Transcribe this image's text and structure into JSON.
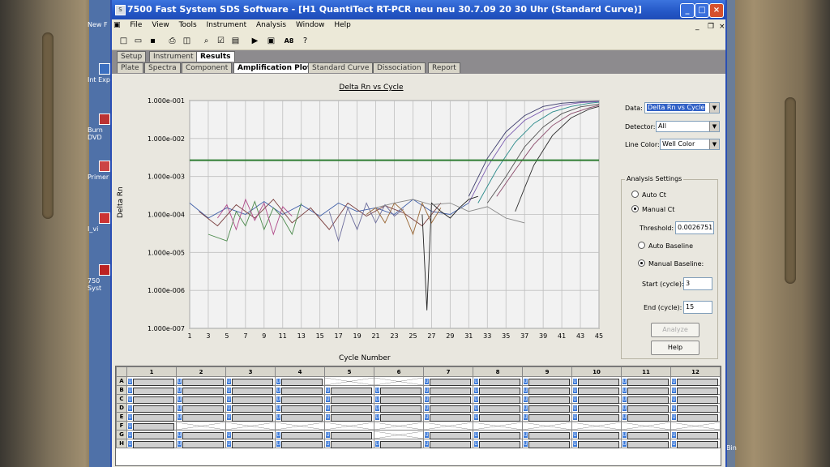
{
  "desktop": {
    "icons": [
      {
        "label": "New F",
        "icon": "folder-icon"
      },
      {
        "label": "Int Exp",
        "icon": "ie-icon"
      },
      {
        "label": "Burn DVD",
        "icon": "burn-icon"
      },
      {
        "label": "Primer",
        "icon": "primer-icon"
      },
      {
        "label": "I_vi",
        "icon": "file-icon"
      },
      {
        "label": "750 Syst",
        "icon": "app-icon"
      }
    ],
    "bin_label": "Bin"
  },
  "window": {
    "title": "7500 Fast System SDS Software - [H1 QuantiTect RT-PCR neu neu  30.7.09 20 30 Uhr (Standard Curve)]",
    "controls": [
      "_",
      "□",
      "×"
    ]
  },
  "menu": [
    "File",
    "View",
    "Tools",
    "Instrument",
    "Analysis",
    "Window",
    "Help"
  ],
  "toolbar_icons": [
    "new-icon",
    "open-icon",
    "save-icon",
    "print-icon",
    "print-preview-icon",
    "zoom-icon",
    "edit-icon",
    "report-icon",
    "run-icon",
    "stop-icon",
    "font-icon",
    "help-icon"
  ],
  "tabs_top": [
    "Setup",
    "Instrument",
    "Results"
  ],
  "tabs_top_active": "Results",
  "tabs_results": [
    "Plate",
    "Spectra",
    "Component",
    "Amplification Plot",
    "Standard Curve",
    "Dissociation",
    "Report"
  ],
  "tabs_results_active": "Amplification Plot",
  "chart_data": {
    "type": "line",
    "title": "Delta Rn vs Cycle",
    "xlabel": "Cycle Number",
    "ylabel": "Delta Rn",
    "y_scale": "log",
    "ylim": [
      1e-07,
      0.1
    ],
    "xlim": [
      1,
      45
    ],
    "y_ticks": [
      "1.000e-001",
      "1.000e-002",
      "1.000e-003",
      "1.000e-004",
      "1.000e-005",
      "1.000e-006",
      "1.000e-007"
    ],
    "x_ticks": [
      1,
      3,
      5,
      7,
      9,
      11,
      13,
      15,
      17,
      19,
      21,
      23,
      25,
      27,
      29,
      31,
      33,
      35,
      37,
      39,
      41,
      43,
      45
    ],
    "threshold": 0.0026751,
    "threshold_color": "#2e7d32",
    "grid": true,
    "series": [
      {
        "color": "#3b3b6b",
        "x": [
          31,
          33,
          35,
          37,
          39,
          41,
          43,
          45
        ],
        "y": [
          0.0003,
          0.003,
          0.015,
          0.04,
          0.07,
          0.085,
          0.092,
          0.095
        ]
      },
      {
        "color": "#7a5bb0",
        "x": [
          31,
          33,
          35,
          37,
          39,
          41,
          43,
          45
        ],
        "y": [
          0.0002,
          0.0018,
          0.01,
          0.03,
          0.055,
          0.075,
          0.088,
          0.094
        ]
      },
      {
        "color": "#2a8a8a",
        "x": [
          32,
          34,
          36,
          38,
          40,
          42,
          44,
          45
        ],
        "y": [
          0.0002,
          0.0015,
          0.008,
          0.025,
          0.05,
          0.07,
          0.085,
          0.09
        ]
      },
      {
        "color": "#555555",
        "x": [
          33,
          35,
          37,
          39,
          41,
          43,
          45
        ],
        "y": [
          0.0002,
          0.001,
          0.006,
          0.02,
          0.045,
          0.068,
          0.08
        ]
      },
      {
        "color": "#8a4a6a",
        "x": [
          34,
          36,
          38,
          40,
          42,
          44,
          45
        ],
        "y": [
          0.0003,
          0.0015,
          0.007,
          0.022,
          0.045,
          0.065,
          0.075
        ]
      },
      {
        "color": "#2f2f2f",
        "x": [
          36,
          37,
          38,
          40,
          42,
          44,
          45
        ],
        "y": [
          0.00012,
          0.0005,
          0.002,
          0.012,
          0.035,
          0.06,
          0.07
        ]
      },
      {
        "color": "#3e5ea8",
        "x": [
          1,
          3,
          5,
          7,
          9,
          11,
          13,
          15,
          17,
          19,
          21,
          23,
          25,
          27,
          29,
          31
        ],
        "y": [
          0.0002,
          8e-05,
          0.00015,
          0.0001,
          0.00022,
          0.0001,
          0.00018,
          9e-05,
          0.0002,
          0.00012,
          0.00015,
          0.0001,
          0.00025,
          0.00012,
          0.0001,
          0.0002
        ]
      },
      {
        "color": "#7a3f3f",
        "x": [
          2,
          4,
          6,
          8,
          10,
          12,
          14,
          16,
          18,
          20,
          22,
          24,
          26,
          28
        ],
        "y": [
          0.00012,
          5e-05,
          0.00018,
          8e-05,
          0.00025,
          6e-05,
          0.00015,
          4e-05,
          0.0002,
          9e-05,
          0.00017,
          0.00011,
          5e-05,
          0.0002
        ]
      },
      {
        "color": "#4b8a4b",
        "x": [
          3,
          5,
          6,
          7,
          8,
          9,
          10,
          11,
          12,
          13
        ],
        "y": [
          3e-05,
          2e-05,
          0.00012,
          5e-05,
          0.00022,
          4e-05,
          0.00015,
          8e-05,
          3e-05,
          0.0002
        ]
      },
      {
        "color": "#b04a8a",
        "x": [
          4,
          5,
          6,
          7,
          8,
          9,
          10,
          11,
          12
        ],
        "y": [
          8e-05,
          0.00018,
          4e-05,
          0.00025,
          7e-05,
          0.0002,
          3e-05,
          0.00016,
          9e-05
        ]
      },
      {
        "color": "#6a6a9a",
        "x": [
          16,
          17,
          18,
          19,
          20,
          21,
          22,
          23,
          24
        ],
        "y": [
          0.00012,
          2e-05,
          0.00015,
          4e-05,
          0.0002,
          6e-05,
          0.00018,
          9e-05,
          0.00014
        ]
      },
      {
        "color": "#996633",
        "x": [
          20,
          21,
          22,
          23,
          24,
          25,
          26,
          27,
          28
        ],
        "y": [
          0.0001,
          0.00015,
          6e-05,
          0.0002,
          0.00012,
          3e-05,
          0.0002,
          6e-05,
          0.00015
        ]
      },
      {
        "color": "#222222",
        "x": [
          26,
          26.5,
          27,
          28,
          29,
          30,
          31,
          32
        ],
        "y": [
          0.0001,
          3e-07,
          0.0002,
          0.00012,
          8e-05,
          0.00015,
          0.00025,
          0.0003
        ]
      },
      {
        "color": "#888888",
        "x": [
          21,
          23,
          25,
          27,
          29,
          31,
          33,
          35,
          37
        ],
        "y": [
          0.00015,
          0.0002,
          0.00025,
          0.00018,
          0.0002,
          0.00012,
          0.00016,
          8e-05,
          6e-05
        ]
      }
    ]
  },
  "side": {
    "data_label": "Data:",
    "data_value": "Delta Rn vs Cycle",
    "detector_label": "Detector:",
    "detector_value": "All",
    "linecolor_label": "Line Color:",
    "linecolor_value": "Well Color"
  },
  "analysis": {
    "title": "Analysis Settings",
    "auto_ct": "Auto Ct",
    "manual_ct": "Manual Ct",
    "threshold_label": "Threshold:",
    "threshold_value": "0.0026751",
    "auto_baseline": "Auto Baseline",
    "manual_baseline": "Manual Baseline:",
    "start_label": "Start (cycle):",
    "start_value": "3",
    "end_label": "End (cycle):",
    "end_value": "15",
    "analyze_label": "Analyze",
    "help_label": "Help"
  },
  "plate": {
    "columns": [
      "1",
      "2",
      "3",
      "4",
      "5",
      "6",
      "7",
      "8",
      "9",
      "10",
      "11",
      "12"
    ],
    "rows": [
      "A",
      "B",
      "C",
      "D",
      "E",
      "F",
      "G",
      "H"
    ],
    "well_label": "U",
    "used": {
      "A": [
        1,
        1,
        1,
        1,
        0,
        0,
        1,
        1,
        1,
        1,
        1,
        1
      ],
      "B": [
        1,
        1,
        1,
        1,
        1,
        1,
        1,
        1,
        1,
        1,
        1,
        1
      ],
      "C": [
        1,
        1,
        1,
        1,
        1,
        1,
        1,
        1,
        1,
        1,
        1,
        1
      ],
      "D": [
        1,
        1,
        1,
        1,
        1,
        1,
        1,
        1,
        1,
        1,
        1,
        1
      ],
      "E": [
        1,
        1,
        1,
        1,
        1,
        1,
        1,
        1,
        1,
        1,
        1,
        1
      ],
      "F": [
        1,
        0,
        0,
        0,
        0,
        0,
        0,
        0,
        0,
        0,
        0,
        0
      ],
      "G": [
        1,
        1,
        1,
        1,
        1,
        0,
        1,
        1,
        1,
        1,
        1,
        1
      ],
      "H": [
        1,
        1,
        1,
        1,
        1,
        1,
        1,
        1,
        1,
        1,
        1,
        1
      ]
    }
  }
}
